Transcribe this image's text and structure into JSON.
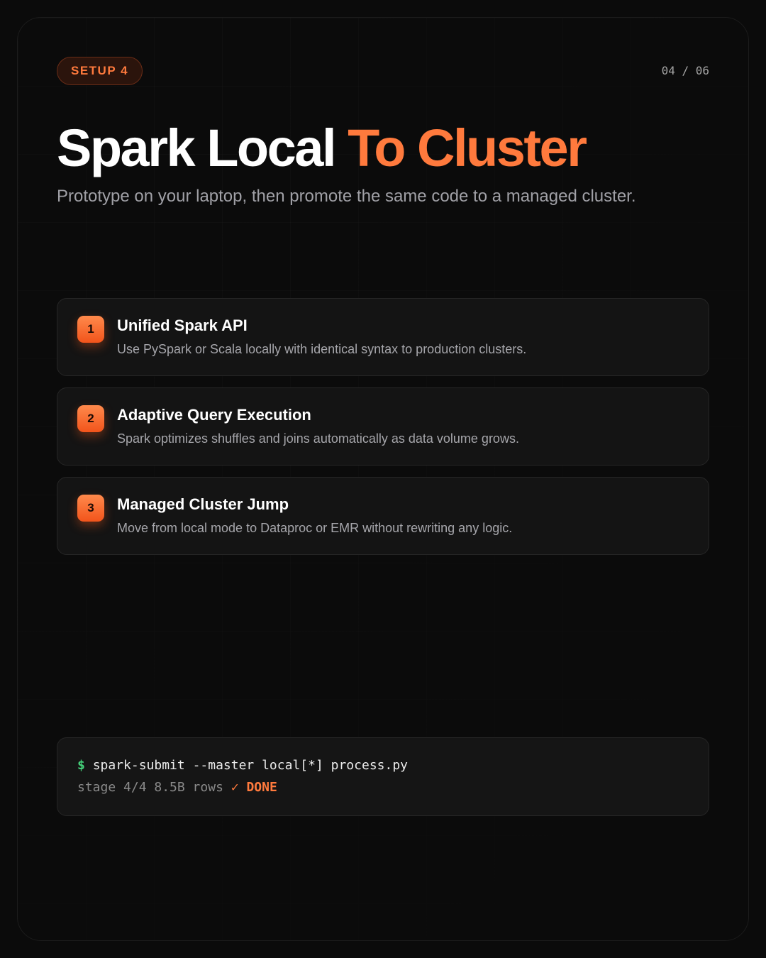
{
  "header": {
    "pill_label": "SETUP 4",
    "counter": "04 / 06"
  },
  "hero": {
    "title_main": "Spark Local ",
    "title_accent": "To Cluster",
    "subtitle": "Prototype on your laptop, then promote the same code to a managed cluster."
  },
  "steps": [
    {
      "number": "1",
      "title": "Unified Spark API",
      "description": "Use PySpark or Scala locally with identical syntax to production clusters."
    },
    {
      "number": "2",
      "title": "Adaptive Query Execution",
      "description": "Spark optimizes shuffles and joins automatically as data volume grows."
    },
    {
      "number": "3",
      "title": "Managed Cluster Jump",
      "description": "Move from local mode to Dataproc or EMR without rewriting any logic."
    }
  ],
  "terminal": {
    "prompt": "$",
    "command": "spark-submit --master local[*] process.py",
    "output": "stage 4/4 8.5B rows",
    "check": "✓",
    "status": "DONE"
  },
  "colors": {
    "accent": "#ff7a3d",
    "prompt": "#45d07a",
    "background": "#0b0b0b"
  }
}
